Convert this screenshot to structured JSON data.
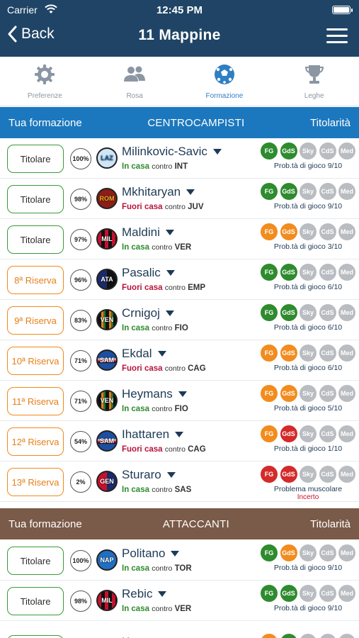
{
  "status_bar": {
    "carrier": "Carrier",
    "time": "12:45 PM"
  },
  "nav": {
    "back_label": "Back",
    "title": "11 Mappine"
  },
  "tabs": [
    {
      "label": "Preferenze",
      "icon": "gear-icon",
      "active": false
    },
    {
      "label": "Rosa",
      "icon": "people-icon",
      "active": false
    },
    {
      "label": "Formazione",
      "icon": "soccer-ball-icon",
      "active": true
    },
    {
      "label": "Leghe",
      "icon": "trophy-icon",
      "active": false
    }
  ],
  "colors": {
    "nav": "#1f4466",
    "section_mid": "#1c78be",
    "section_att": "#7a5a48",
    "green": "#2e8b2e",
    "orange": "#f28c1e",
    "red": "#d42a2a",
    "grey": "#b9bcc0"
  },
  "source_labels": [
    "FG",
    "GdS",
    "Sky",
    "CdS",
    "Med"
  ],
  "sections": [
    {
      "left": "Tua formazione",
      "title": "CENTROCAMPISTI",
      "right": "Titolarità",
      "players": [
        {
          "status": "Titolare",
          "reserve": false,
          "pct": "100%",
          "team": "LAZ",
          "name": "Milinkovic-Savic",
          "venue": "In casa",
          "home": true,
          "contro": "contro",
          "opp": "INT",
          "sources": [
            "g",
            "g",
            "n",
            "n",
            "n"
          ],
          "prob": "Prob.tà di gioco 9/10"
        },
        {
          "status": "Titolare",
          "reserve": false,
          "pct": "98%",
          "team": "ROM",
          "name": "Mkhitaryan",
          "venue": "Fuori casa",
          "home": false,
          "contro": "contro",
          "opp": "JUV",
          "sources": [
            "g",
            "g",
            "n",
            "n",
            "n"
          ],
          "prob": "Prob.tà di gioco 9/10"
        },
        {
          "status": "Titolare",
          "reserve": false,
          "pct": "97%",
          "team": "MIL",
          "name": "Maldini",
          "venue": "In casa",
          "home": true,
          "contro": "contro",
          "opp": "VER",
          "sources": [
            "o",
            "o",
            "n",
            "n",
            "n"
          ],
          "prob": "Prob.tà di gioco 3/10"
        },
        {
          "status": "8ª Riserva",
          "reserve": true,
          "pct": "96%",
          "team": "ATA",
          "name": "Pasalic",
          "venue": "Fuori casa",
          "home": false,
          "contro": "contro",
          "opp": "EMP",
          "sources": [
            "g",
            "g",
            "n",
            "n",
            "n"
          ],
          "prob": "Prob.tà di gioco 6/10"
        },
        {
          "status": "9ª Riserva",
          "reserve": true,
          "pct": "83%",
          "team": "VEN",
          "name": "Crnigoj",
          "venue": "In casa",
          "home": true,
          "contro": "contro",
          "opp": "FIO",
          "sources": [
            "g",
            "g",
            "n",
            "n",
            "n"
          ],
          "prob": "Prob.tà di gioco 6/10"
        },
        {
          "status": "10ª Riserva",
          "reserve": true,
          "pct": "71%",
          "team": "SAM",
          "name": "Ekdal",
          "venue": "Fuori casa",
          "home": false,
          "contro": "contro",
          "opp": "CAG",
          "sources": [
            "o",
            "o",
            "n",
            "n",
            "n"
          ],
          "prob": "Prob.tà di gioco 6/10"
        },
        {
          "status": "11ª Riserva",
          "reserve": true,
          "pct": "71%",
          "team": "VEN",
          "name": "Heymans",
          "venue": "In casa",
          "home": true,
          "contro": "contro",
          "opp": "FIO",
          "sources": [
            "o",
            "o",
            "n",
            "n",
            "n"
          ],
          "prob": "Prob.tà di gioco 5/10"
        },
        {
          "status": "12ª Riserva",
          "reserve": true,
          "pct": "54%",
          "team": "SAM",
          "name": "Ihattaren",
          "venue": "Fuori casa",
          "home": false,
          "contro": "contro",
          "opp": "CAG",
          "sources": [
            "o",
            "r",
            "n",
            "n",
            "n"
          ],
          "prob": "Prob.tà di gioco 1/10"
        },
        {
          "status": "13ª Riserva",
          "reserve": true,
          "pct": "2%",
          "team": "GEN",
          "name": "Sturaro",
          "venue": "In casa",
          "home": true,
          "contro": "contro",
          "opp": "SAS",
          "sources": [
            "r",
            "r",
            "n",
            "n",
            "n"
          ],
          "prob": "Problema muscolare",
          "prob2": "Incerto"
        }
      ]
    },
    {
      "left": "Tua formazione",
      "title": "ATTACCANTI",
      "right": "Titolarità",
      "players": [
        {
          "status": "Titolare",
          "reserve": false,
          "pct": "100%",
          "team": "NAP",
          "name": "Politano",
          "venue": "In casa",
          "home": true,
          "contro": "contro",
          "opp": "TOR",
          "sources": [
            "g",
            "o",
            "n",
            "n",
            "n"
          ],
          "prob": "Prob.tà di gioco 9/10"
        },
        {
          "status": "Titolare",
          "reserve": false,
          "pct": "98%",
          "team": "MIL",
          "name": "Rebic",
          "venue": "In casa",
          "home": true,
          "contro": "contro",
          "opp": "VER",
          "sources": [
            "g",
            "g",
            "n",
            "n",
            "n"
          ],
          "prob": "Prob.tà di gioco 9/10"
        },
        {
          "status": "",
          "reserve": false,
          "pct": "",
          "team": "JUV",
          "name": "Kean",
          "venue": "",
          "home": true,
          "contro": "",
          "opp": "",
          "sources": [
            "o",
            "g",
            "n",
            "n",
            "n"
          ],
          "prob": ""
        }
      ]
    }
  ]
}
